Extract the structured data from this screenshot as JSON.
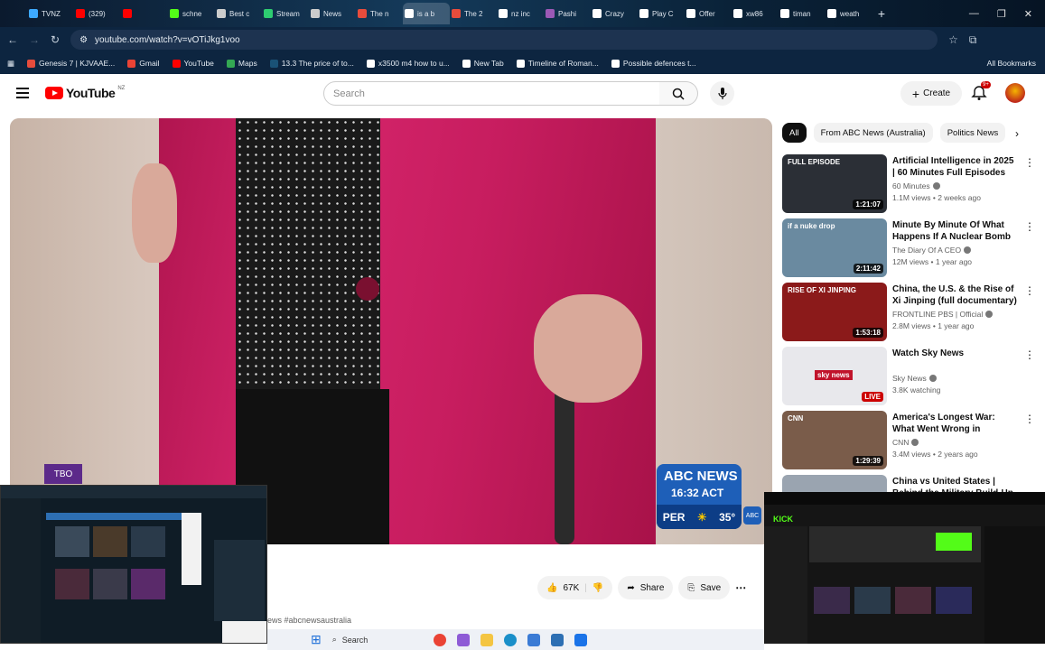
{
  "browser": {
    "tabs": [
      {
        "label": "TVNZ",
        "icon": "plus-icon",
        "color": "#3da9ff"
      },
      {
        "label": "(329)",
        "icon": "youtube-icon",
        "color": "#ff0000"
      },
      {
        "label": "",
        "icon": "youtube-icon",
        "color": "#ff0000"
      },
      {
        "label": "schne",
        "icon": "kick-icon",
        "color": "#53fc18"
      },
      {
        "label": "Best c",
        "icon": "page-icon",
        "color": "#cccccc"
      },
      {
        "label": "Stream",
        "icon": "stream-icon",
        "color": "#2ecc71"
      },
      {
        "label": "News",
        "icon": "page-icon",
        "color": "#cccccc"
      },
      {
        "label": "The n",
        "icon": "app-icon",
        "color": "#e74c3c"
      },
      {
        "label": "is a b",
        "icon": "google-icon",
        "color": "#ffffff"
      },
      {
        "label": "The 2",
        "icon": "app-icon",
        "color": "#e74c3c"
      },
      {
        "label": "nz inc",
        "icon": "google-icon",
        "color": "#ffffff"
      },
      {
        "label": "Pashi",
        "icon": "page-icon",
        "color": "#9b59b6"
      },
      {
        "label": "Crazy",
        "icon": "s-icon",
        "color": "#ffffff"
      },
      {
        "label": "Play C",
        "icon": "s-icon",
        "color": "#ffffff"
      },
      {
        "label": "Offer",
        "icon": "s-icon",
        "color": "#ffffff"
      },
      {
        "label": "xw86",
        "icon": "google-icon",
        "color": "#ffffff"
      },
      {
        "label": "timan",
        "icon": "google-icon",
        "color": "#ffffff"
      },
      {
        "label": "weath",
        "icon": "google-icon",
        "color": "#ffffff"
      }
    ],
    "url": "youtube.com/watch?v=vOTiJkg1voo",
    "bookmarks": [
      {
        "label": "Genesis 7 | KJVAAE...",
        "color": "#e74c3c"
      },
      {
        "label": "Gmail",
        "color": "#ea4335"
      },
      {
        "label": "YouTube",
        "color": "#ff0000"
      },
      {
        "label": "Maps",
        "color": "#34a853"
      },
      {
        "label": "13.3 The price of to...",
        "color": "#1a5276"
      },
      {
        "label": "x3500 m4 how to u...",
        "color": "#ffffff"
      },
      {
        "label": "New Tab",
        "color": "#ffffff"
      },
      {
        "label": "Timeline of Roman...",
        "color": "#ffffff"
      },
      {
        "label": "Possible defences t...",
        "color": "#ffffff"
      }
    ],
    "all_bookmarks": "All Bookmarks"
  },
  "youtube": {
    "logo_text": "YouTube",
    "region": "NZ",
    "search_placeholder": "Search",
    "create_label": "Create",
    "notif_count": "9+"
  },
  "video": {
    "badge_brand": "ABC NEWS",
    "badge_time": "16:32 ACT",
    "badge_city": "PER",
    "badge_temp": "35°",
    "corner_tag": "ABC",
    "tb_tag": "TBO"
  },
  "actions": {
    "likes": "67K",
    "share": "Share",
    "save": "Save",
    "hashtags": "ews #abcnewsaustralia"
  },
  "chips": [
    "All",
    "From ABC News (Australia)",
    "Politics News"
  ],
  "recommended": [
    {
      "title": "Artificial Intelligence in 2025 | 60 Minutes Full Episodes",
      "channel": "60 Minutes",
      "meta": "1.1M views • 2 weeks ago",
      "duration": "1:21:07",
      "thumb_label": "FULL EPISODE",
      "live": false,
      "bg": "#2b2f36"
    },
    {
      "title": "Minute By Minute Of What Happens If A Nuclear Bomb ...",
      "channel": "The Diary Of A CEO",
      "meta": "12M views • 1 year ago",
      "duration": "2:11:42",
      "thumb_label": "if a nuke drop",
      "live": false,
      "bg": "#6a8aa0"
    },
    {
      "title": "China, the U.S. & the Rise of Xi Jinping (full documentary) | ...",
      "channel": "FRONTLINE PBS | Official",
      "meta": "2.8M views • 1 year ago",
      "duration": "1:53:18",
      "thumb_label": "RISE OF XI JINPING",
      "live": false,
      "bg": "#8b1a1a"
    },
    {
      "title": "Watch Sky News",
      "channel": "Sky News",
      "meta": "3.8K watching",
      "duration": "LIVE",
      "thumb_label": "sky news",
      "live": true,
      "bg": "#e8e8ec"
    },
    {
      "title": "America's Longest War: What Went Wrong in Afghanistan ...",
      "channel": "CNN",
      "meta": "3.4M views • 2 years ago",
      "duration": "1:29:39",
      "thumb_label": "CNN",
      "live": false,
      "bg": "#7a5c4a"
    },
    {
      "title": "China vs United States | Behind the Military Build-Up ...",
      "channel": "",
      "meta": "",
      "duration": "",
      "thumb_label": "",
      "live": false,
      "bg": "#9aa4b0"
    }
  ],
  "taskbar": {
    "search": "Search"
  },
  "colors": {
    "accent": "#ff0000",
    "abc_blue": "#1e5fb8",
    "coat": "#c71d5f"
  }
}
